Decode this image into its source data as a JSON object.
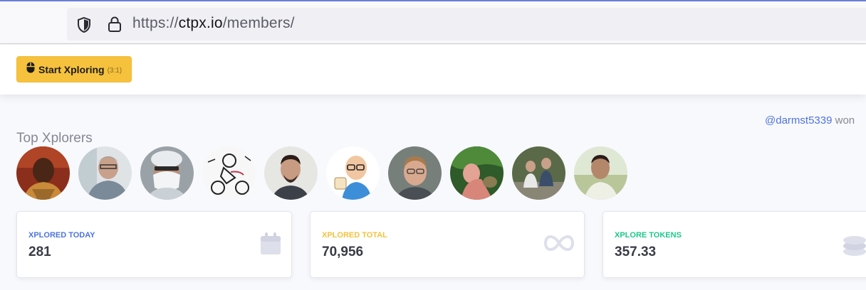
{
  "browser": {
    "url_prefix": "https://",
    "url_host": "ctpx.io",
    "url_path": "/members/",
    "icons": [
      "shield-icon",
      "lock-icon"
    ]
  },
  "toolbar": {
    "start_label": "Start Xploring",
    "start_hotkey": "(3:1)",
    "start_icon": "mouse-icon",
    "accent": "#f6c23e"
  },
  "winner": {
    "user": "@darmst5339",
    "text": "won"
  },
  "top_xplorers": {
    "title": "Top Xplorers",
    "count": 10
  },
  "stats": [
    {
      "label": "XPLORED TODAY",
      "value": "281",
      "icon": "calendar-icon",
      "color": "#4e73df"
    },
    {
      "label": "XPLORED TOTAL",
      "value": "70,956",
      "icon": "infinity-icon",
      "color": "#f6c23e"
    },
    {
      "label": "XPLORE TOKENS",
      "value": "357.33",
      "icon": "coins-icon",
      "color": "#1cc88a"
    }
  ]
}
